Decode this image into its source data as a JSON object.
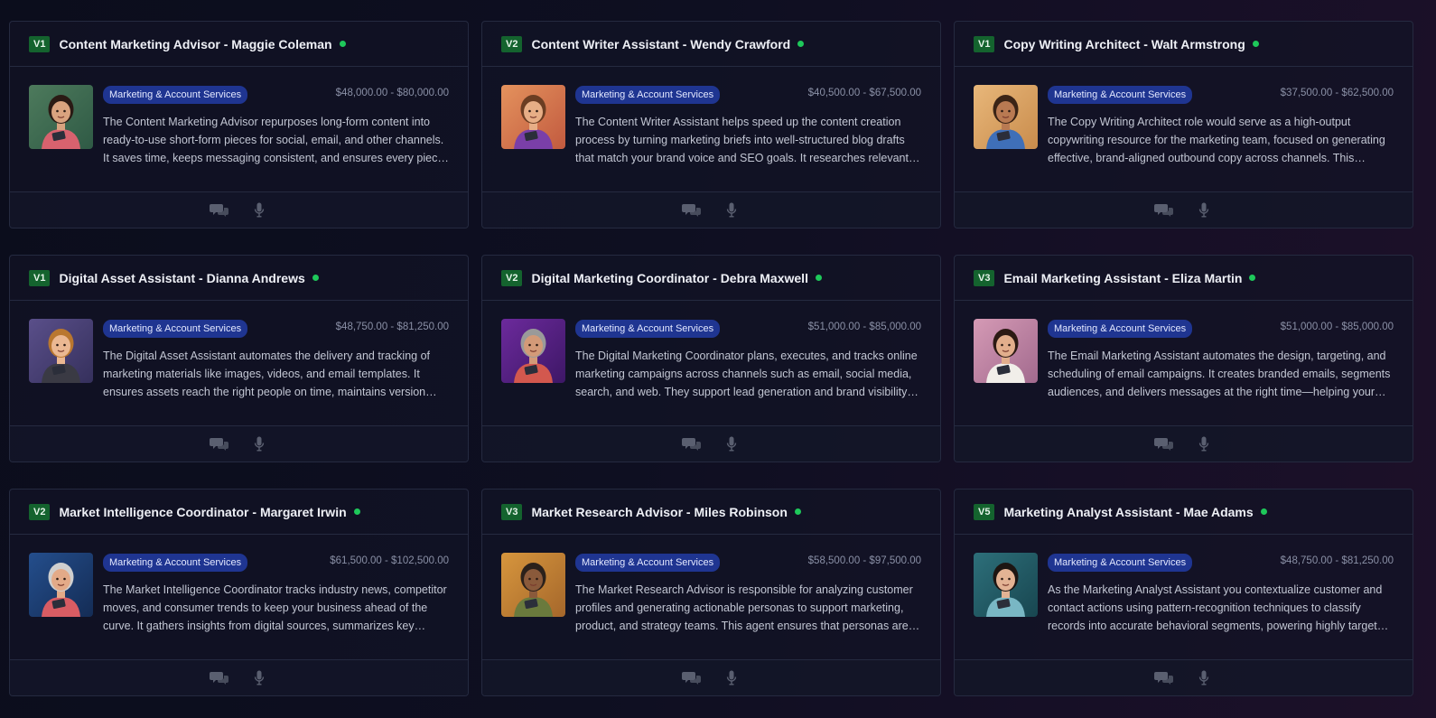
{
  "colors": {
    "version_badge": "#14632e",
    "tag": "#1f3591",
    "online": "#1ec85a",
    "background": "#0e0f21"
  },
  "icons": {
    "chat": "chat-bubbles-icon",
    "voice": "microphone-icon",
    "status": "online-status-dot"
  },
  "cards": [
    {
      "version": "V1",
      "title": "Content Marketing Advisor - Maggie Coleman",
      "category": "Marketing & Account Services",
      "salary": "$48,000.00 - $80,000.00",
      "description": "The Content Marketing Advisor repurposes long-form content into ready-to-use short-form pieces for social, email, and other channels. It saves time, keeps messaging consistent, and ensures every piece is optimized for its channel.",
      "avatar": {
        "bg1": "#4d7a5c",
        "bg2": "#2f5a45",
        "hair": "#2a1a14",
        "skin": "#d9a37f",
        "shirt": "#d8626e"
      }
    },
    {
      "version": "V2",
      "title": "Content Writer Assistant - Wendy Crawford",
      "category": "Marketing & Account Services",
      "salary": "$40,500.00 - $67,500.00",
      "description": "The Content Writer Assistant helps speed up the content creation process by turning marketing briefs into well-structured blog drafts that match your brand voice and SEO goals. It researches relevant topics and keywords.",
      "avatar": {
        "bg1": "#e4925d",
        "bg2": "#c25a3f",
        "hair": "#6b3d22",
        "skin": "#e7ae86",
        "shirt": "#7a3fa8"
      }
    },
    {
      "version": "V1",
      "title": "Copy Writing Architect - Walt Armstrong",
      "category": "Marketing & Account Services",
      "salary": "$37,500.00 - $62,500.00",
      "description": "The Copy Writing Architect role would serve as a high-output copywriting resource for the marketing team, focused on generating effective, brand-aligned outbound copy across channels. This persona drafts and refines messaging.",
      "avatar": {
        "bg1": "#e8b77a",
        "bg2": "#c98c4c",
        "hair": "#3b2416",
        "skin": "#b97a52",
        "shirt": "#3f6fb8"
      }
    },
    {
      "version": "V1",
      "title": "Digital Asset Assistant - Dianna Andrews",
      "category": "Marketing & Account Services",
      "salary": "$48,750.00 - $81,250.00",
      "description": "The Digital Asset Assistant automates the delivery and tracking of marketing materials like images, videos, and email templates. It ensures assets reach the right people on time, maintains version control and history.",
      "avatar": {
        "bg1": "#5a4f8a",
        "bg2": "#35305c",
        "hair": "#b9772f",
        "skin": "#ebb892",
        "shirt": "#3a3a44"
      }
    },
    {
      "version": "V2",
      "title": "Digital Marketing Coordinator - Debra Maxwell",
      "category": "Marketing & Account Services",
      "salary": "$51,000.00 - $85,000.00",
      "description": "The Digital Marketing Coordinator plans, executes, and tracks online marketing campaigns across channels such as email, social media, search, and web. They support lead generation and brand visibility efforts.",
      "avatar": {
        "bg1": "#6c2a9c",
        "bg2": "#3d1766",
        "hair": "#9a9a9a",
        "skin": "#d39a78",
        "shirt": "#d3584e"
      }
    },
    {
      "version": "V3",
      "title": "Email Marketing Assistant - Eliza Martin",
      "category": "Marketing & Account Services",
      "salary": "$51,000.00 - $85,000.00",
      "description": "The Email Marketing Assistant automates the design, targeting, and scheduling of email campaigns. It creates branded emails, segments audiences, and delivers messages at the right time—helping your team engage customers.",
      "avatar": {
        "bg1": "#d59ab5",
        "bg2": "#a26a8e",
        "hair": "#2c1a14",
        "skin": "#e2ae8c",
        "shirt": "#f1eee9"
      }
    },
    {
      "version": "V2",
      "title": "Market Intelligence Coordinator - Margaret Irwin",
      "category": "Marketing & Account Services",
      "salary": "$61,500.00 - $102,500.00",
      "description": "The Market Intelligence Coordinator tracks industry news, competitor moves, and consumer trends to keep your business ahead of the curve. It gathers insights from digital sources, summarizes key findings for stakeholders.",
      "avatar": {
        "bg1": "#244e8c",
        "bg2": "#142c55",
        "hair": "#cfcfcf",
        "skin": "#e3aa88",
        "shirt": "#d85c63"
      }
    },
    {
      "version": "V3",
      "title": "Market Research Advisor - Miles Robinson",
      "category": "Marketing & Account Services",
      "salary": "$58,500.00 - $97,500.00",
      "description": "The Market Research Advisor is responsible for analyzing customer profiles and generating actionable personas to support marketing, product, and strategy teams. This agent ensures that personas are accurate and current.",
      "avatar": {
        "bg1": "#d7963d",
        "bg2": "#a5672b",
        "hair": "#2b211b",
        "skin": "#8a5a3b",
        "shirt": "#6a7a3d"
      }
    },
    {
      "version": "V5",
      "title": "Marketing Analyst Assistant - Mae Adams",
      "category": "Marketing & Account Services",
      "salary": "$48,750.00 - $81,250.00",
      "description": "As the Marketing Analyst Assistant you contextualize customer and contact actions using pattern-recognition techniques to classify records into accurate behavioral segments, powering highly targeted campaigns.",
      "avatar": {
        "bg1": "#2d6f7a",
        "bg2": "#184650",
        "hair": "#1d1512",
        "skin": "#e3b394",
        "shirt": "#79b7c4"
      }
    }
  ]
}
